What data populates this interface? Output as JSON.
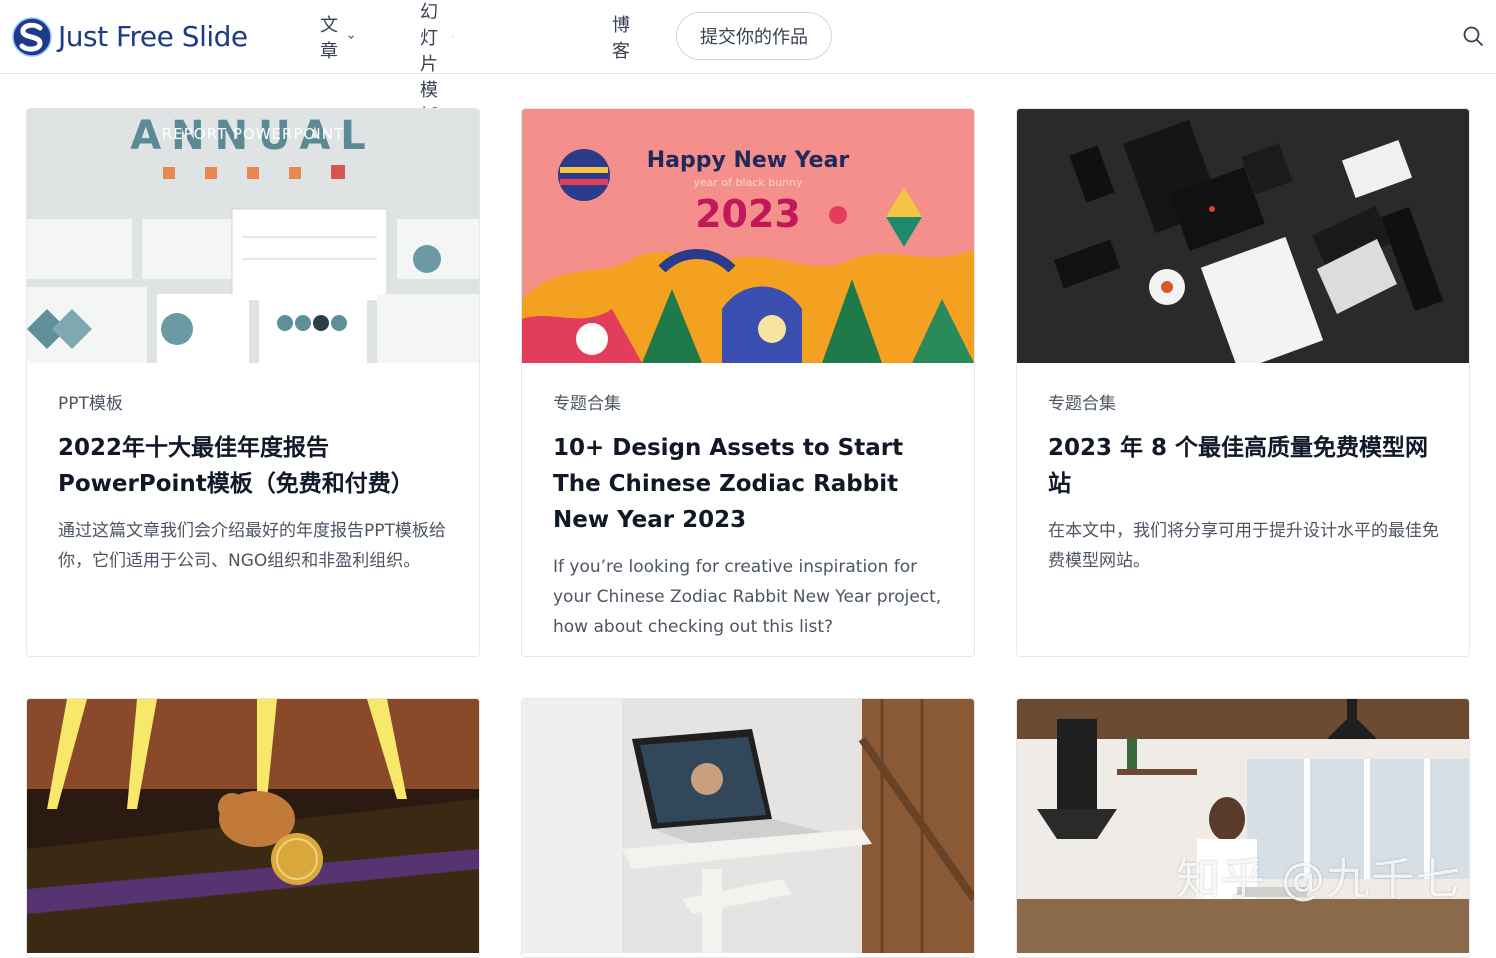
{
  "header": {
    "logo_text": "Just Free Slide",
    "nav": [
      {
        "label": "文章",
        "has_dropdown": true
      },
      {
        "label": "免费幻灯片模板",
        "has_dropdown": true
      },
      {
        "label": "博客",
        "has_dropdown": false
      }
    ],
    "submit_label": "提交你的作品",
    "search_icon": "search-icon"
  },
  "cards": [
    {
      "category": "PPT模板",
      "title": "2022年十大最佳年度报告PowerPoint模板（免费和付费）",
      "excerpt": "通过这篇文章我们会介绍最好的年度报告PPT模板给你，它们适用于公司、NGO组织和非盈利组织。",
      "thumb": {
        "heading": "ANNUAL",
        "subheading": "REPORT POWERPOINT"
      }
    },
    {
      "category": "专题合集",
      "title": "10+ Design Assets to Start The Chinese Zodiac Rabbit New Year 2023",
      "excerpt": "If you’re looking for creative inspiration for your Chinese Zodiac Rabbit New Year project, how about checking out this list?",
      "thumb": {
        "heading": "Happy New Year",
        "subheading": "year of black bunny",
        "year": "2023"
      }
    },
    {
      "category": "专题合集",
      "title": "2023 年 8 个最佳高质量免费模型网站",
      "excerpt": "在本文中，我们将分享可用于提升设计水平的最佳免费模型网站。",
      "thumb": {}
    },
    {
      "thumb": {}
    },
    {
      "thumb": {}
    },
    {
      "thumb": {}
    }
  ],
  "watermark": "知乎 @九千七",
  "colors": {
    "brand": "#1e3a8a",
    "pink_bg": "#f58f8c",
    "title_red": "#c2185b"
  }
}
